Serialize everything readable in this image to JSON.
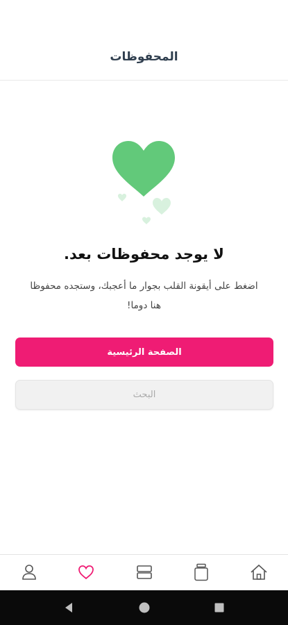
{
  "header": {
    "title": "المحفوظات"
  },
  "empty_state": {
    "title": "لا يوجد محفوظات بعد.",
    "description": "اضغط على أيقونة القلب بجوار ما أعجبك، وستجده محفوظا هنا دوما!"
  },
  "buttons": {
    "home_label": "الصفحة الرئيسية",
    "search_label": "البحث"
  },
  "tabbar": {
    "items": [
      {
        "icon": "profile-icon",
        "active": false
      },
      {
        "icon": "heart-icon",
        "active": true
      },
      {
        "icon": "categories-icon",
        "active": false
      },
      {
        "icon": "jar-icon",
        "active": false
      },
      {
        "icon": "home-icon",
        "active": false
      }
    ]
  },
  "colors": {
    "accent": "#ef1c74",
    "heart_green": "#62c97a",
    "title": "#2f3e4e"
  }
}
